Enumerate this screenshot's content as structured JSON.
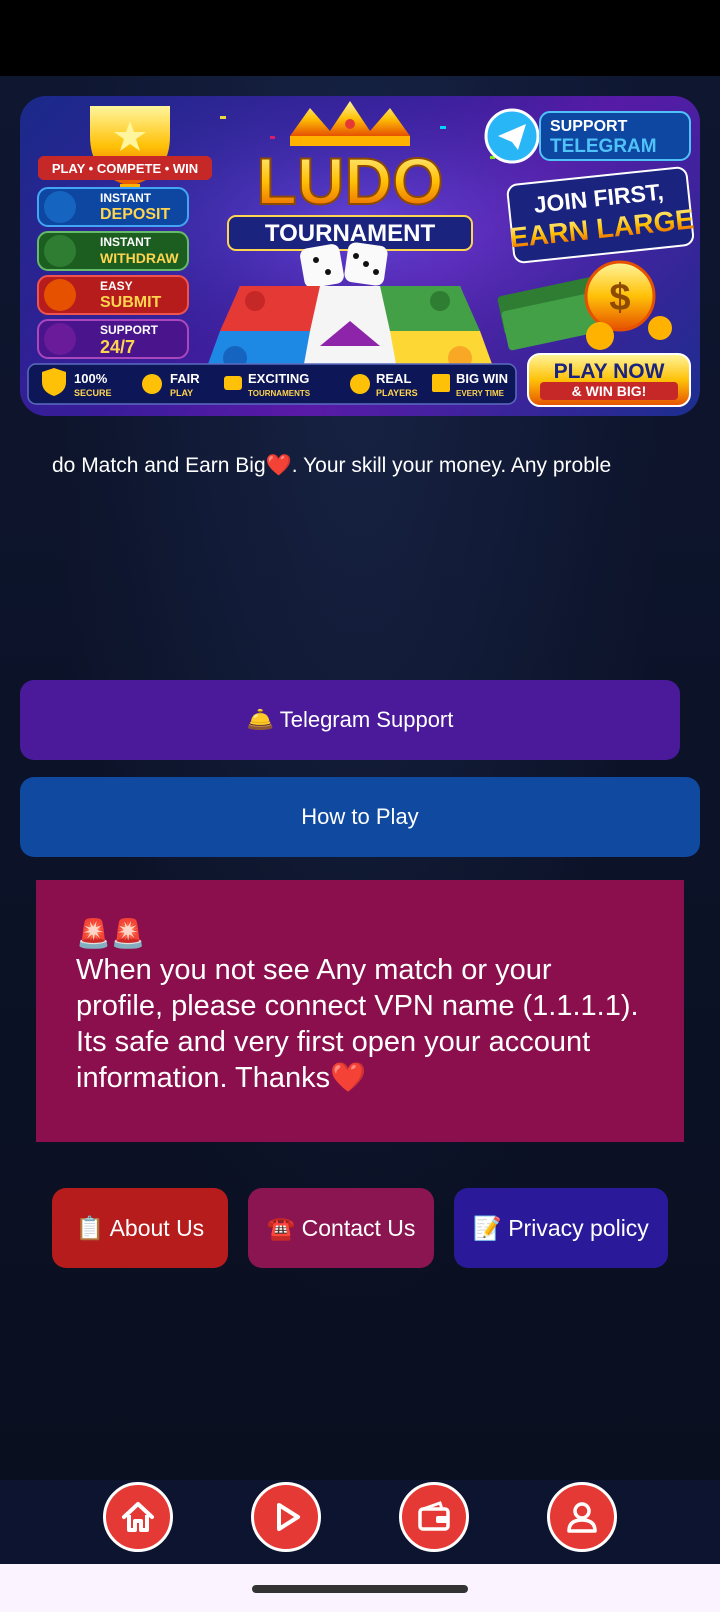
{
  "banner": {
    "tagline": "PLAY • COMPETE • WIN",
    "title_main": "LUDO",
    "title_sub": "TOURNAMENT",
    "support": {
      "line1": "SUPPORT",
      "line2": "TELEGRAM"
    },
    "promo": {
      "line1": "JOIN FIRST,",
      "line2": "EARN LARGE"
    },
    "features": [
      {
        "small": "INSTANT",
        "big": "DEPOSIT"
      },
      {
        "small": "INSTANT",
        "big": "WITHDRAW"
      },
      {
        "small": "EASY",
        "big": "SUBMIT"
      },
      {
        "small": "SUPPORT",
        "big": "24/7"
      }
    ],
    "badges": [
      {
        "big": "100%",
        "small": "SECURE"
      },
      {
        "big": "FAIR",
        "small": "PLAY"
      },
      {
        "big": "EXCITING",
        "small": "TOURNAMENTS"
      },
      {
        "big": "REAL",
        "small": "PLAYERS"
      },
      {
        "big": "BIG WIN",
        "small": "EVERY TIME"
      }
    ],
    "cta": {
      "line1": "PLAY NOW",
      "line2": "& WIN BIG!"
    }
  },
  "marquee": {
    "text": "do Match and Earn Big❤️. Your skill your money. Any proble"
  },
  "buttons": {
    "telegram": "🛎️ Telegram Support",
    "how_to_play": "How to Play"
  },
  "notice": {
    "icons": "🚨🚨",
    "text": "When you not see Any match or your profile, please connect VPN name (1.1.1.1). Its safe and very first open your account information. Thanks❤️"
  },
  "footer": {
    "about": "📋 About Us",
    "contact": "☎️ Contact Us",
    "privacy": "📝 Privacy policy"
  },
  "colors": {
    "accent_red": "#e53935",
    "telegram_btn": "#4a1a9a",
    "howto_btn": "#0f4aa0",
    "notice_bg": "#8a0f4c"
  }
}
